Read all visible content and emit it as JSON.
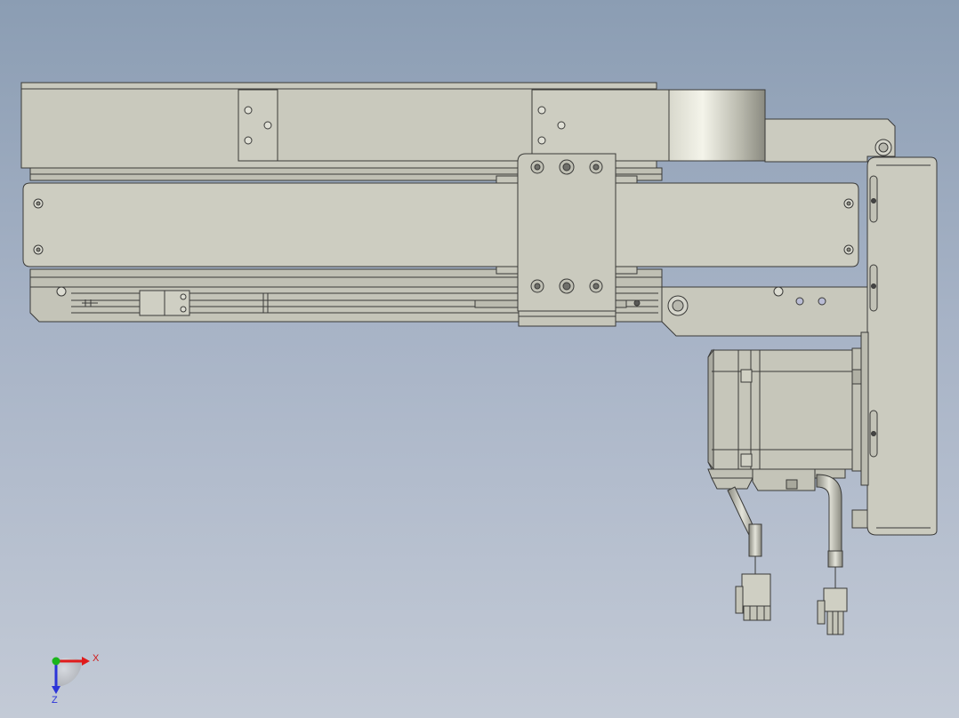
{
  "viewport": {
    "background_top": "#8b9db3",
    "background_bottom": "#c3cad6"
  },
  "model": {
    "body_color": "#c9c9bd",
    "edge_color": "#3a3a38",
    "shadow_color": "#9c9c92",
    "highlight_color": "#e7e7dd"
  },
  "triad": {
    "x_label": "X",
    "z_label": "Z",
    "x_color": "#e01b1b",
    "y_color": "#1bb51b",
    "z_color": "#2b34d8"
  }
}
